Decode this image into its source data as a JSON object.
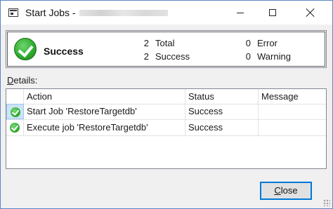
{
  "window": {
    "title": "Start Jobs -",
    "title_suffix_blurred": true
  },
  "summary": {
    "status": "Success",
    "total_count": "2",
    "total_label": "Total",
    "success_count": "2",
    "success_label": "Success",
    "error_count": "0",
    "error_label": "Error",
    "warning_count": "0",
    "warning_label": "Warning"
  },
  "details": {
    "label_accel": "D",
    "label_rest": "etails:",
    "columns": [
      "Action",
      "Status",
      "Message"
    ],
    "rows": [
      {
        "icon": "success-check-icon",
        "action": "Start Job 'RestoreTargetdb'",
        "status": "Success",
        "message": ""
      },
      {
        "icon": "success-check-icon",
        "action": "Execute job 'RestoreTargetdb'",
        "status": "Success",
        "message": ""
      }
    ]
  },
  "buttons": {
    "close_accel": "C",
    "close_rest": "lose"
  },
  "colors": {
    "success_green": "#2fae2f",
    "selection_blue": "#cce4f7",
    "focus_border": "#0078d7"
  }
}
